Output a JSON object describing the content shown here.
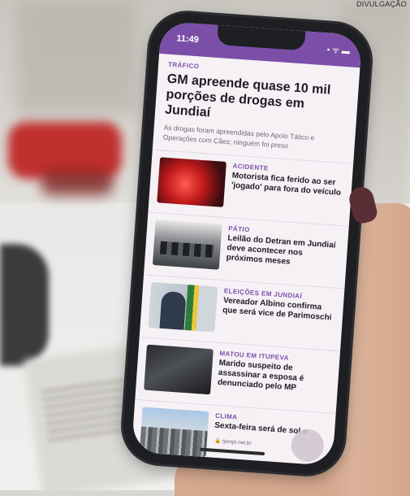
{
  "photo_credit": "DIVULGAÇÃO",
  "status_bar": {
    "time": "11:49",
    "icons": "• ᯤ ▬"
  },
  "lead": {
    "kicker": "TRÁFICO",
    "title": "GM apreende quase 10 mil porções de drogas em Jundiaí",
    "subtitle": "As drogas foram apreendidas pelo Apoio Tático e Operações com Cães; ninguém foi preso"
  },
  "articles": [
    {
      "kicker": "ACIDENTE",
      "title": "Motorista fica ferido ao ser 'jogado' para fora do veículo"
    },
    {
      "kicker": "PÁTIO",
      "title": "Leilão do Detran em Jundiaí deve acontecer nos próximos meses"
    },
    {
      "kicker": "ELEIÇÕES EM JUNDIAÍ",
      "title": "Vereador Albino confirma que será vice de Parimoschi"
    },
    {
      "kicker": "MATOU EM ITUPEVA",
      "title": "Marido suspeito de assassinar a esposa é denunciado pelo MP"
    },
    {
      "kicker": "CLIMA",
      "title": "Sexta-feira será de sol e"
    }
  ],
  "url": "🔒 tjempi.net.br"
}
